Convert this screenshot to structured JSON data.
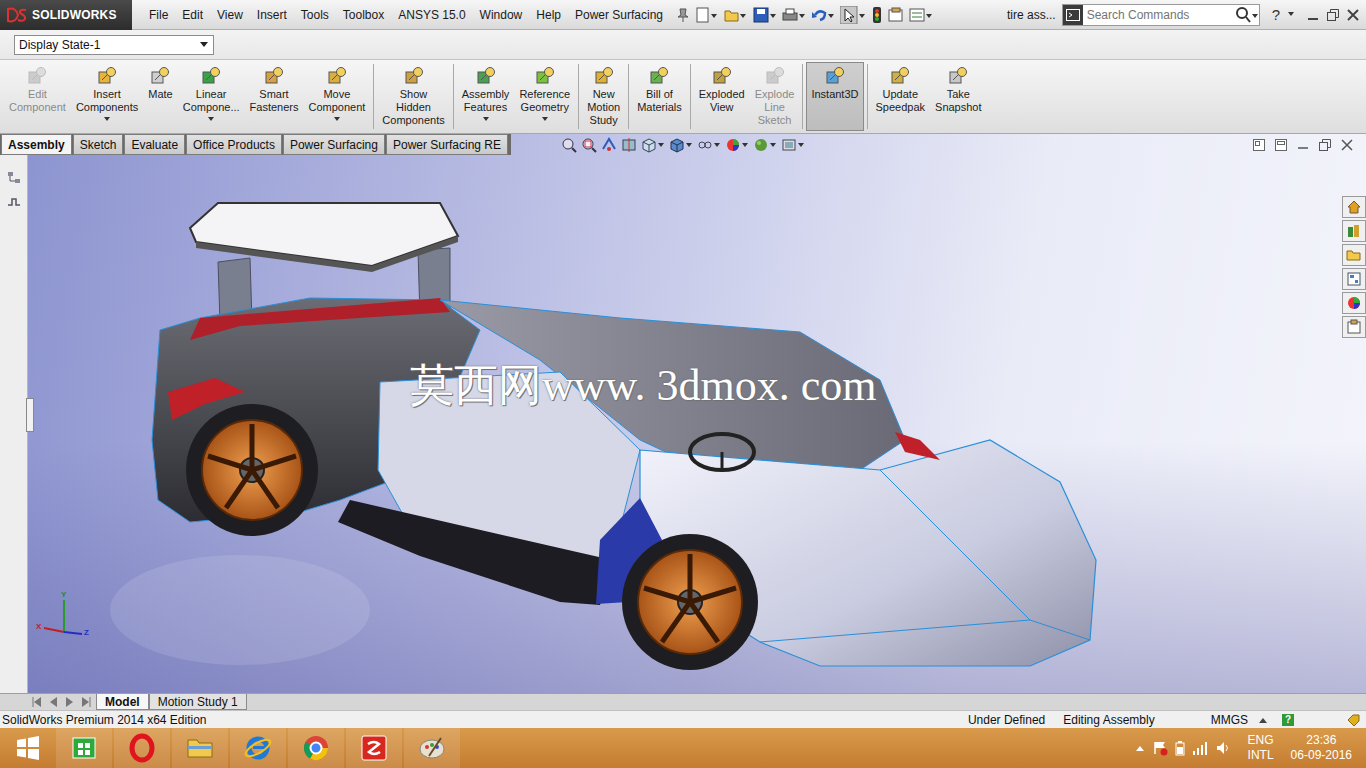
{
  "app": {
    "logo": "SOLIDWORKS"
  },
  "menu": [
    "File",
    "Edit",
    "View",
    "Insert",
    "Tools",
    "Toolbox",
    "ANSYS 15.0",
    "Window",
    "Help",
    "Power Surfacing"
  ],
  "document_title": "tire ass...",
  "search": {
    "placeholder": "Search Commands"
  },
  "help": "?",
  "display_state": "Display State-1",
  "ribbon": [
    {
      "label": "Edit Component",
      "disabled": true,
      "selected": false,
      "dropdown": false,
      "separator_after": false
    },
    {
      "label": "Insert Components",
      "disabled": false,
      "selected": false,
      "dropdown": true,
      "separator_after": false
    },
    {
      "label": "Mate",
      "disabled": false,
      "selected": false,
      "dropdown": false,
      "separator_after": false
    },
    {
      "label": "Linear Compone...",
      "disabled": false,
      "selected": false,
      "dropdown": true,
      "separator_after": false
    },
    {
      "label": "Smart Fasteners",
      "disabled": false,
      "selected": false,
      "dropdown": false,
      "separator_after": false
    },
    {
      "label": "Move Component",
      "disabled": false,
      "selected": false,
      "dropdown": true,
      "separator_after": true
    },
    {
      "label": "Show Hidden Components",
      "disabled": false,
      "selected": false,
      "dropdown": false,
      "separator_after": true
    },
    {
      "label": "Assembly Features",
      "disabled": false,
      "selected": false,
      "dropdown": true,
      "separator_after": false
    },
    {
      "label": "Reference Geometry",
      "disabled": false,
      "selected": false,
      "dropdown": true,
      "separator_after": true
    },
    {
      "label": "New Motion Study",
      "disabled": false,
      "selected": false,
      "dropdown": false,
      "separator_after": true
    },
    {
      "label": "Bill of Materials",
      "disabled": false,
      "selected": false,
      "dropdown": false,
      "separator_after": true
    },
    {
      "label": "Exploded View",
      "disabled": false,
      "selected": false,
      "dropdown": false,
      "separator_after": false
    },
    {
      "label": "Explode Line Sketch",
      "disabled": true,
      "selected": false,
      "dropdown": false,
      "separator_after": true
    },
    {
      "label": "Instant3D",
      "disabled": false,
      "selected": true,
      "dropdown": false,
      "separator_after": true
    },
    {
      "label": "Update Speedpak",
      "disabled": false,
      "selected": false,
      "dropdown": false,
      "separator_after": false
    },
    {
      "label": "Take Snapshot",
      "disabled": false,
      "selected": false,
      "dropdown": false,
      "separator_after": false
    }
  ],
  "tabs": [
    {
      "label": "Assembly",
      "selected": true
    },
    {
      "label": "Sketch",
      "selected": false
    },
    {
      "label": "Evaluate",
      "selected": false
    },
    {
      "label": "Office Products",
      "selected": false
    },
    {
      "label": "Power Surfacing",
      "selected": false
    },
    {
      "label": "Power Surfacing RE",
      "selected": false
    }
  ],
  "watermark": "莫西网www. 3dmox. com",
  "triad": {
    "x": "X",
    "y": "Y",
    "z": "Z"
  },
  "bottom_tabs": [
    {
      "label": "Model",
      "selected": true
    },
    {
      "label": "Motion Study 1",
      "selected": false
    }
  ],
  "status_bar": {
    "edition": "SolidWorks Premium 2014 x64 Edition",
    "definition": "Under Defined",
    "mode": "Editing Assembly",
    "units": "MMGS",
    "help_badge": "?"
  },
  "taskbar": {
    "language": "ENG",
    "layout": "INTL",
    "time": "23:36",
    "date": "06-09-2016"
  }
}
